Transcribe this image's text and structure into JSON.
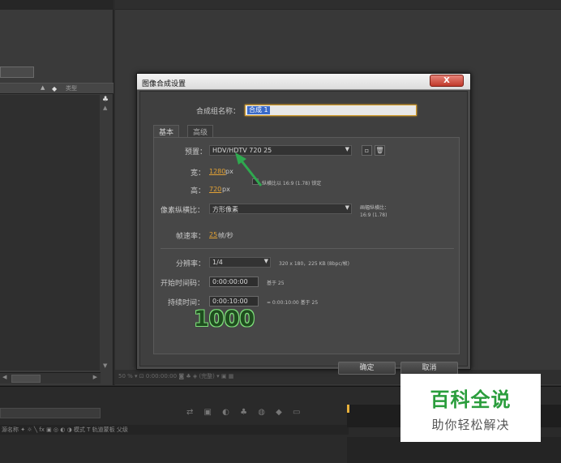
{
  "project_panel": {
    "type_column": "类型"
  },
  "dialog": {
    "title": "图像合成设置",
    "close_label": "X",
    "comp_name_label": "合成组名称：",
    "comp_name_value": "合成 1",
    "tabs": [
      {
        "label": "基本"
      },
      {
        "label": "高级"
      }
    ],
    "preset_label": "预置：",
    "preset_value": "HDV/HDTV 720 25",
    "width_label": "宽：",
    "width_value": "1280",
    "width_unit": "px",
    "height_label": "高：",
    "height_value": "720",
    "height_unit": "px",
    "lock_aspect_label": "纵横比以 16:9 (1.78) 锁定",
    "pixel_aspect_label": "像素纵横比：",
    "pixel_aspect_value": "方形像素",
    "frame_aspect_label": "画幅纵横比：",
    "frame_aspect_value": "16:9 (1.78)",
    "frame_rate_label": "帧速率：",
    "frame_rate_value": "25",
    "frame_rate_unit": "帧/秒",
    "resolution_label": "分辨率：",
    "resolution_value": "1/4",
    "resolution_info": "320 x 180，225 KB (8bpc/帧)",
    "start_timecode_label": "开始时间码：",
    "start_timecode_value": "0:00:00:00",
    "start_timecode_note": "基于 25",
    "duration_label": "持续时间：",
    "duration_value": "0:00:10:00",
    "duration_note": "= 0:00:10:00  基于 25",
    "ok_label": "确定",
    "cancel_label": "取消"
  },
  "annotation": {
    "number": "1000",
    "arrow_color": "#2fa84f"
  },
  "viewer_toolbar": {
    "text": "50 %  ▾   ⊡   0:00:00:00   ◙  ♣  ◈  (完整)  ▾   ▣  ▦"
  },
  "timeline": {
    "columns": "源名称               ✦ ☼ ╲ fx ▣ ◎ ◐ ◑   模式          T   轨道蒙板       父级"
  },
  "watermark": {
    "title": "百科全说",
    "subtitle": "助你轻松解决"
  },
  "colors": {
    "accent_orange": "#e3a235",
    "close_red": "#c0392b",
    "watermark_green": "#2a9d3c"
  }
}
